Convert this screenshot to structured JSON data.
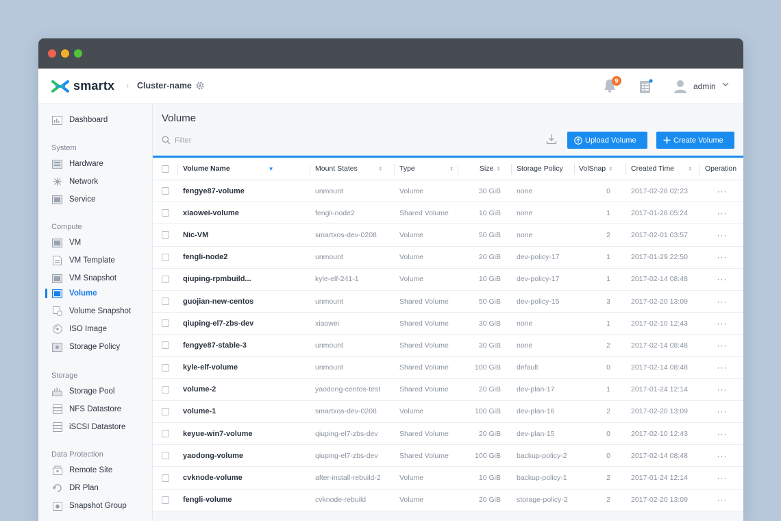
{
  "header": {
    "brand": "smartx",
    "cluster_name": "Cluster-name",
    "notification_count": "9",
    "user_name": "admin"
  },
  "sidebar": {
    "dashboard": "Dashboard",
    "sections": [
      {
        "title": "System",
        "items": [
          "Hardware",
          "Network",
          "Service"
        ]
      },
      {
        "title": "Compute",
        "items": [
          "VM",
          "VM Template",
          "VM Snapshot",
          "Volume",
          "Volume Snapshot",
          "ISO Image",
          "Storage Policy"
        ]
      },
      {
        "title": "Storage",
        "items": [
          "Storage Pool",
          "NFS Datastore",
          "iSCSI Datastore"
        ]
      },
      {
        "title": "Data Protection",
        "items": [
          "Remote Site",
          "DR Plan",
          "Snapshot Group"
        ]
      }
    ],
    "active_item": "Volume"
  },
  "main": {
    "title": "Volume",
    "filter_placeholder": "Filter",
    "upload_button": "Upload Volume",
    "create_button": "Create Volume"
  },
  "table": {
    "columns": [
      "Volume Name",
      "Mount States",
      "Type",
      "Size",
      "Storage Policy",
      "VolSnap",
      "Created Time",
      "Operation"
    ],
    "rows": [
      [
        "fengye87-volume",
        "unmount",
        "Volume",
        "30 GiB",
        "none",
        "0",
        "2017-02-28  02:23"
      ],
      [
        "xiaowei-volume",
        "fengli-node2",
        "Shared Volume",
        "10 GiB",
        "none",
        "1",
        "2017-01-28  05:24"
      ],
      [
        "Nic-VM",
        "smartxos-dev-0208",
        "Volume",
        "50 GiB",
        "none",
        "2",
        "2017-02-01  03:57"
      ],
      [
        "fengli-node2",
        "unmount",
        "Volume",
        "20 GiB",
        "dev-policy-17",
        "1",
        "2017-01-29  22:50"
      ],
      [
        "qiuping-rpmbuild...",
        "kyle-elf-241-1",
        "Volume",
        "10 GiB",
        "dev-policy-17",
        "1",
        "2017-02-14  08:48"
      ],
      [
        "guojian-new-centos",
        "unmount",
        "Shared Volume",
        "50 GiB",
        "dev-policy-15",
        "3",
        "2017-02-20  13:09"
      ],
      [
        "qiuping-el7-zbs-dev",
        "xiaowei",
        "Shared Volume",
        "30 GiB",
        "none",
        "1",
        "2017-02-10  12:43"
      ],
      [
        "fengye87-stable-3",
        "unmount",
        "Shared Volume",
        "30 GiB",
        "none",
        "2",
        "2017-02-14  08:48"
      ],
      [
        "kyle-elf-volume",
        "unmount",
        "Shared Volume",
        "100 GiB",
        "default",
        "0",
        "2017-02-14  08:48"
      ],
      [
        "volume-2",
        "yaodong-centos-test",
        "Shared Volume",
        "20 GiB",
        "dev-plan-17",
        "1",
        "2017-01-24  12:14"
      ],
      [
        "volume-1",
        "smartxos-dev-0208",
        "Volume",
        "100 GiB",
        "dev-plan-16",
        "2",
        "2017-02-20  13:09"
      ],
      [
        "keyue-win7-volume",
        "qiuping-el7-zbs-dev",
        "Shared Volume",
        "20 GiB",
        "dev-plan-15",
        "0",
        "2017-02-10  12:43"
      ],
      [
        "yaodong-volume",
        "qiuping-el7-zbs-dev",
        "Shared Volume",
        "100 GiB",
        "backup-policy-2",
        "0",
        "2017-02-14  08:48"
      ],
      [
        "cvknode-volume",
        "after-install-rebuild-2",
        "Volume",
        "10 GiB",
        "backup-policy-1",
        "2",
        "2017-01-24  12:14"
      ],
      [
        "fengli-volume",
        "cvknode-rebuild",
        "Volume",
        "20 GiB",
        "storage-policy-2",
        "2",
        "2017-02-20  13:09"
      ]
    ],
    "operation_glyph": "···"
  },
  "colors": {
    "accent": "#1a8cf0",
    "titlebar": "#474c53",
    "badge": "#f2762e",
    "background": "#b8c8db"
  }
}
